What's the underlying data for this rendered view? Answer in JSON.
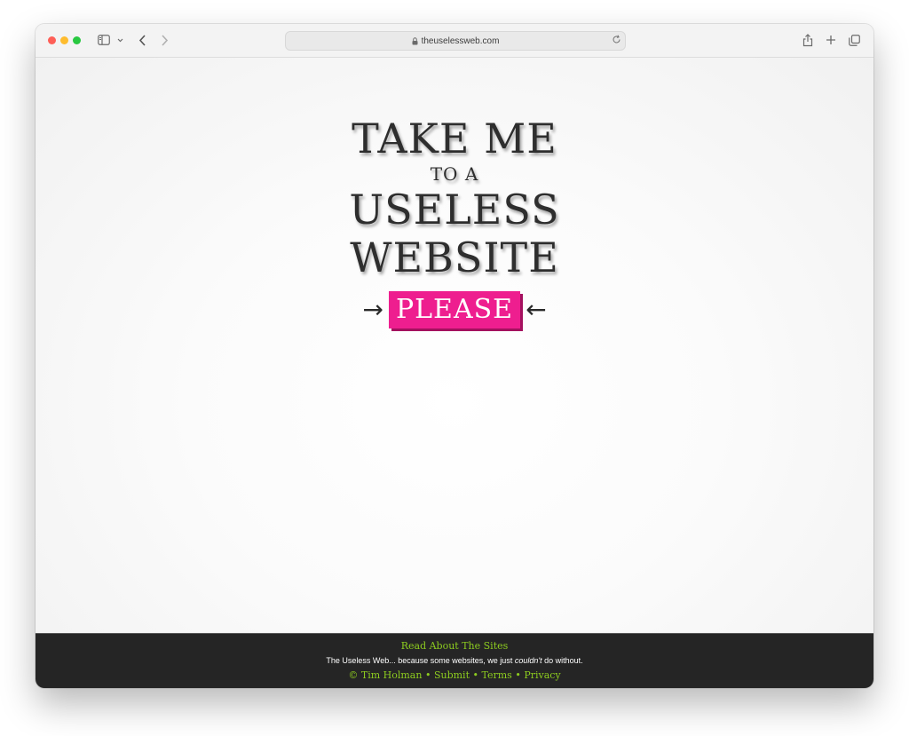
{
  "browser": {
    "url": "theuselessweb.com"
  },
  "hero": {
    "line1": "TAKE ME",
    "line2": "TO A",
    "line3": "USELESS",
    "line4": "WEBSITE",
    "button_label": "PLEASE",
    "arrow_left": "→",
    "arrow_right": "←"
  },
  "footer": {
    "read_about": "Read About The Sites",
    "tagline_prefix": "The Useless Web... because some websites, we just ",
    "tagline_emphasis": "couldn't",
    "tagline_suffix": " do without.",
    "author": "© Tim Holman",
    "sep": "•",
    "submit": "Submit",
    "terms": "Terms",
    "privacy": "Privacy"
  },
  "colors": {
    "accent_pink": "#ee1e8f",
    "footer_link_green": "#8dcc1f",
    "footer_bg": "#252525"
  },
  "icons": {
    "sidebar": "sidebar-icon",
    "chevron": "chevron-down-icon",
    "back": "back-arrow-icon",
    "forward": "forward-arrow-icon",
    "lock": "lock-icon",
    "reload": "reload-icon",
    "share": "share-icon",
    "new_tab": "plus-icon",
    "tabs": "tab-overview-icon"
  }
}
